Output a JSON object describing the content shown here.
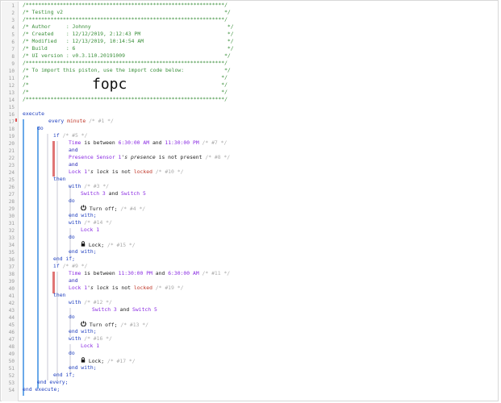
{
  "gutter_numbers": [
    "1",
    "2",
    "3",
    "4",
    "5",
    "6",
    "7",
    "8",
    "9",
    "10",
    "11",
    "12",
    "13",
    "14",
    "15",
    "16",
    "17",
    "18",
    "19",
    "20",
    "21",
    "22",
    "23",
    "24",
    "25",
    "26",
    "27",
    "28",
    "29",
    "30",
    "31",
    "32",
    "33",
    "34",
    "35",
    "36",
    "37",
    "38",
    "39",
    "40",
    "41",
    "42",
    "43",
    "44",
    "45",
    "46",
    "47",
    "48",
    "49",
    "50",
    "51",
    "52",
    "53",
    "54"
  ],
  "header": {
    "stars": "/****************************************************************/",
    "title": "/* Testing v2                                                    */",
    "author": "/* Author     : Johnny                                            */",
    "created": "/* Created    : 12/12/2019, 2:12:43 PM                            */",
    "modified": "/* Modified   : 12/13/2019, 10:14:54 AM                           */",
    "build": "/* Build      : 6                                                 */",
    "ui_version": "/* UI version : v0.3.110.20191009                                */",
    "import_note": "/* To import this piston, use the import code below:             */",
    "blank": "/*                                                              */",
    "import_code": "fopc"
  },
  "code": {
    "execute": "execute",
    "every": "every",
    "minute": "minute",
    "c1": "/* #1 */",
    "do": "do",
    "if": "if",
    "c5": "/* #5 */",
    "time": "Time",
    "is_between": "is between",
    "t630": "6:30:00 AM",
    "and_word": "and",
    "t1130": "11:30:00 PM",
    "c7": "/* #7 */",
    "presence_sensor": "Presence Sensor 1",
    "presence_attr": "'s presence",
    "is_not_present": "is not present",
    "c8": "/* #8 */",
    "lock1": "Lock 1",
    "lock_attr": "'s lock",
    "is_not": "is not",
    "locked": "locked",
    "c10": "/* #10 */",
    "then": "then",
    "with": "with",
    "c3": "/* #3 */",
    "switch3": "Switch 3",
    "switch5": "Switch 5",
    "turn_off": "Turn off;",
    "c4": "/* #4 */",
    "end_with": "end with;",
    "c14": "/* #14 */",
    "lock_cmd": "Lock;",
    "c15": "/* #15 */",
    "end_if": "end if;",
    "c9": "/* #9 */",
    "c11": "/* #11 */",
    "c19": "/* #19 */",
    "c12": "/* #12 */",
    "c13": "/* #13 */",
    "c16": "/* #16 */",
    "c17": "/* #17 */",
    "end_every": "end every;",
    "end_execute": "end execute;"
  }
}
